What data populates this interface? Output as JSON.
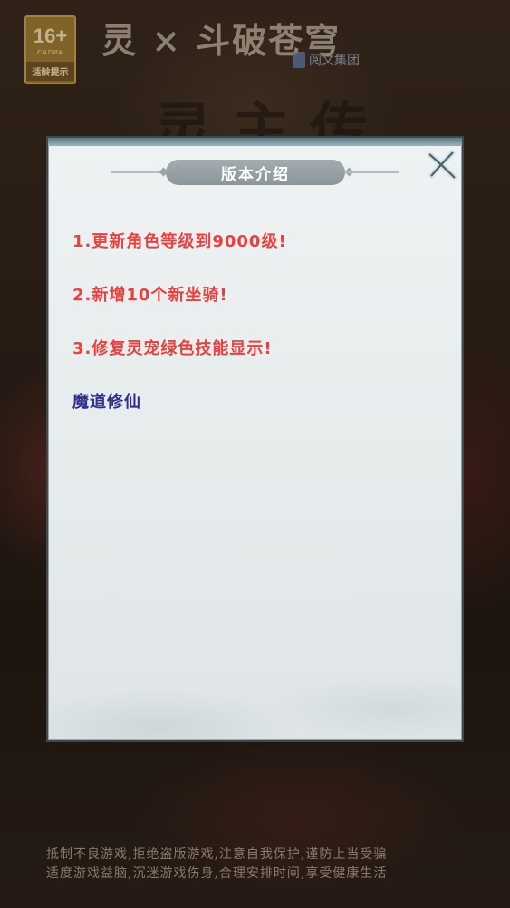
{
  "age_rating": {
    "number": "16+",
    "org": "CADPA",
    "tip": "适龄提示"
  },
  "collab_logo": "灵 × 斗破苍穹",
  "publisher": "阅文集团",
  "background_title": "灵 主 传",
  "dialog": {
    "title": "版本介绍",
    "items": [
      {
        "text": "1.更新角色等级到9000级!",
        "color": "#e8413f"
      },
      {
        "text": "2.新增10个新坐骑!",
        "color": "#e8413f"
      },
      {
        "text": "3.修复灵宠绿色技能显示!",
        "color": "#e8413f"
      },
      {
        "text": "魔道修仙",
        "color": "#2e2e8a"
      }
    ],
    "close_icon": "close-icon"
  },
  "health_notice": [
    "抵制不良游戏,拒绝盗版游戏,注意自我保护,谨防上当受骗",
    "适度游戏益脑,沉迷游戏伤身,合理安排时间,享受健康生活"
  ]
}
